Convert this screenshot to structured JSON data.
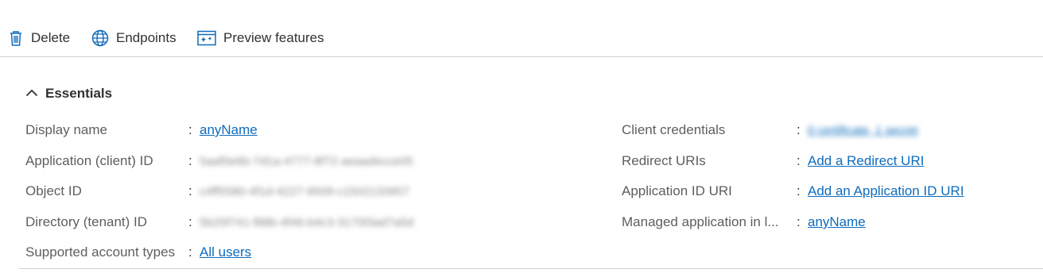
{
  "toolbar": {
    "delete_label": "Delete",
    "endpoints_label": "Endpoints",
    "preview_label": "Preview features"
  },
  "essentials": {
    "title": "Essentials"
  },
  "left": [
    {
      "label": "Display name",
      "value": "anyName"
    },
    {
      "label": "Application (client) ID",
      "value": "5aaf0e6b-7d1a-4777-8f72-aeaadecce05"
    },
    {
      "label": "Object ID",
      "value": "c4ff5580-4f1d-4227-9509-c1502133957"
    },
    {
      "label": "Directory (tenant) ID",
      "value": "5b25f741-f88b-4f46-b4c3-3175f3ad7a5d"
    },
    {
      "label": "Supported account types",
      "value": "All users"
    }
  ],
  "right": [
    {
      "label": "Client credentials",
      "value": "0 certificate, 1 secret"
    },
    {
      "label": "Redirect URIs",
      "value": "Add a Redirect URI"
    },
    {
      "label": "Application ID URI",
      "value": "Add an Application ID URI"
    },
    {
      "label": "Managed application in l...",
      "value": "anyName"
    }
  ],
  "colon": ":",
  "colors": {
    "link": "#0f6cbd",
    "icon": "#0f6cbd",
    "text": "#323130",
    "label": "#605e5c",
    "divider": "#d2d0ce"
  }
}
